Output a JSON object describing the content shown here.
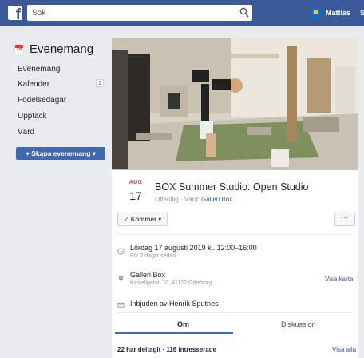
{
  "topbar": {
    "logo": "f",
    "search_placeholder": "Sök",
    "user_name": "Mattias",
    "right_cutoff": "S"
  },
  "sidebar": {
    "title": "Evenemang",
    "calendar_icon_day": "28",
    "items": [
      {
        "label": "Evenemang"
      },
      {
        "label": "Kalender",
        "badge": "1"
      },
      {
        "label": "Födelsedagar"
      },
      {
        "label": "Upptäck"
      },
      {
        "label": "Värd"
      }
    ],
    "create_button": "+ Skapa evenemang ▾"
  },
  "event": {
    "month": "AUG",
    "day": "17",
    "title": "BOX Summer Studio: Open Studio",
    "visibility": "Offentlig · Värd:",
    "host": "Galleri Box",
    "rsvp_button": "✓ Kommer ▾",
    "more_button": "···",
    "time_main": "Lördag 17 augusti 2019 kl. 12:00–16:00",
    "time_sub": "För 2 dagar sedan",
    "location_main": "Galleri Box",
    "location_sub": "Kastellgatan 10, 41122 Göteborg",
    "show_map": "Visa karta",
    "invited_by": "Inbjuden av Henrik Sputnes",
    "tabs": [
      "Om",
      "Diskussion"
    ],
    "active_tab": "Om"
  },
  "attendance": {
    "summary": "22 har deltagit · 116 intresserade",
    "see_all": "Visa alla"
  },
  "colors": {
    "brand": "#3b5998",
    "button": "#4267b2",
    "link": "#365899",
    "date_red": "#e4373d",
    "background": "#e9ebee"
  }
}
